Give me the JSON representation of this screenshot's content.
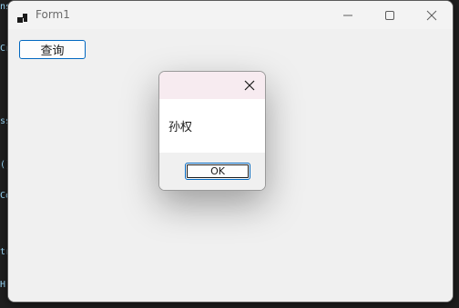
{
  "window": {
    "title": "Form1",
    "icons": {
      "app": "form-app-icon",
      "minimize": "minimize-icon",
      "maximize": "maximize-icon",
      "close": "close-icon"
    }
  },
  "main": {
    "query_button_label": "查询"
  },
  "dialog": {
    "message": "孙权",
    "ok_label": "OK",
    "close_icon": "close-icon"
  },
  "colors": {
    "accent": "#0067c0",
    "dialog_titlebar": "#f7ebf0"
  }
}
